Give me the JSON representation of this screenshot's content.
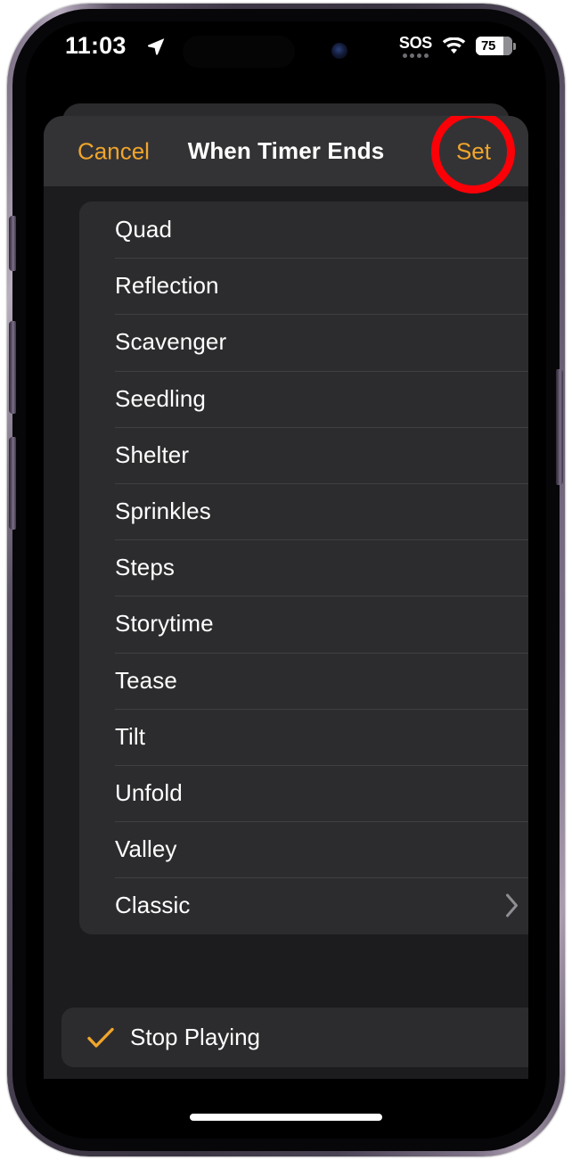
{
  "status_bar": {
    "time": "11:03",
    "location_icon": "location-arrow-icon",
    "sos_label": "SOS",
    "wifi_icon": "wifi-icon",
    "battery_level": "75",
    "battery_percent": 75
  },
  "sheet": {
    "cancel_label": "Cancel",
    "title": "When Timer Ends",
    "set_label": "Set",
    "accent_color": "#f0a52c",
    "highlight_color": "#fb0007",
    "header_bg": "#333335",
    "sheet_bg": "#1c1c1e",
    "card_bg": "#2c2c2e"
  },
  "tones": [
    {
      "label": "Quad",
      "chevron": false
    },
    {
      "label": "Reflection",
      "chevron": false
    },
    {
      "label": "Scavenger",
      "chevron": false
    },
    {
      "label": "Seedling",
      "chevron": false
    },
    {
      "label": "Shelter",
      "chevron": false
    },
    {
      "label": "Sprinkles",
      "chevron": false
    },
    {
      "label": "Steps",
      "chevron": false
    },
    {
      "label": "Storytime",
      "chevron": false
    },
    {
      "label": "Tease",
      "chevron": false
    },
    {
      "label": "Tilt",
      "chevron": false
    },
    {
      "label": "Unfold",
      "chevron": false
    },
    {
      "label": "Valley",
      "chevron": false
    },
    {
      "label": "Classic",
      "chevron": true
    }
  ],
  "stop_playing": {
    "label": "Stop Playing",
    "checked": true,
    "check_icon": "checkmark-icon"
  }
}
